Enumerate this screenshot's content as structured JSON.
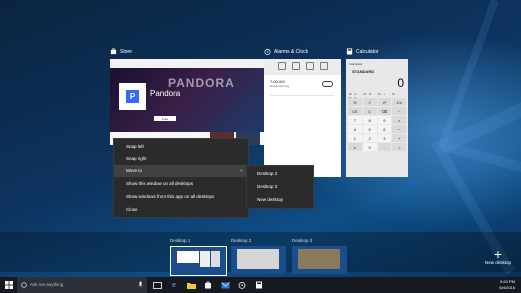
{
  "windows": [
    {
      "id": "store",
      "title": "Store",
      "icon": "store-icon"
    },
    {
      "id": "alarms",
      "title": "Alarms & Clock",
      "icon": "alarm-clock-icon"
    },
    {
      "id": "calculator",
      "title": "Calculator",
      "icon": "calculator-icon"
    }
  ],
  "store": {
    "app_name": "Pandora",
    "brand_text": "PANDORA",
    "logo_letter": "P",
    "button_label": "Free"
  },
  "alarms": {
    "alarm_time": "7:00 AM",
    "alarm_name": "Good morning"
  },
  "calculator": {
    "header": "Calculator",
    "mode": "STANDARD",
    "display": "0",
    "keys": [
      "%",
      "√",
      "x²",
      "1/x",
      "CE",
      "C",
      "⌫",
      "÷",
      "7",
      "8",
      "9",
      "×",
      "4",
      "5",
      "6",
      "−",
      "1",
      "2",
      "3",
      "+",
      "±",
      "0",
      ".",
      "="
    ]
  },
  "context_menu": {
    "items": [
      {
        "label": "Snap left"
      },
      {
        "label": "Snap right"
      },
      {
        "label": "Move to"
      },
      {
        "label": "Show this window on all desktops"
      },
      {
        "label": "Show windows from this app on all desktops"
      },
      {
        "label": "Close"
      }
    ]
  },
  "submenu": {
    "items": [
      {
        "label": "Desktop 2"
      },
      {
        "label": "Desktop 3"
      },
      {
        "label": "New desktop"
      }
    ]
  },
  "desktops": [
    {
      "label": "Desktop 1",
      "active": true
    },
    {
      "label": "Desktop 2",
      "active": false
    },
    {
      "label": "Desktop 3",
      "active": false
    }
  ],
  "new_desktop": {
    "label": "New desktop",
    "icon": "plus-icon"
  },
  "taskbar": {
    "search_placeholder": "Ask me anything",
    "icons": [
      "windows-start-icon",
      "microphone-icon",
      "task-view-icon",
      "edge-icon",
      "file-explorer-icon",
      "store-icon",
      "mail-icon",
      "alarm-clock-icon",
      "calculator-icon"
    ],
    "time": "5:20 PM",
    "date": "6/4/2016"
  },
  "colors": {
    "accent": "#3668ff",
    "menu_bg": "#2b2b2b",
    "taskbar_bg": "#16191f"
  }
}
